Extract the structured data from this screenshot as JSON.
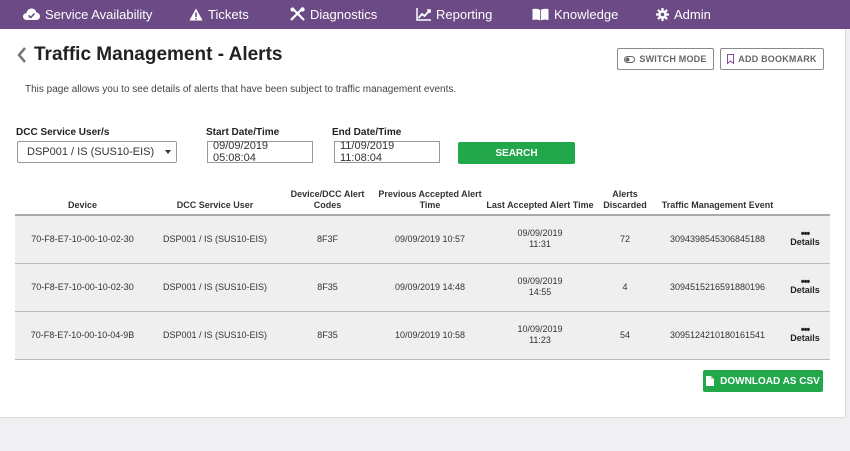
{
  "nav": {
    "items": [
      {
        "label": "Service Availability",
        "icon": "cloud-check-icon"
      },
      {
        "label": "Tickets",
        "icon": "warning-icon"
      },
      {
        "label": "Diagnostics",
        "icon": "tools-icon"
      },
      {
        "label": "Reporting",
        "icon": "line-chart-icon"
      },
      {
        "label": "Knowledge",
        "icon": "book-icon"
      },
      {
        "label": "Admin",
        "icon": "gear-icon"
      }
    ]
  },
  "page": {
    "title": "Traffic Management - Alerts",
    "intro": "This page allows you to see details of alerts that have been subject to traffic management events.",
    "switch_mode": "SWITCH MODE",
    "add_bookmark": "ADD BOOKMARK"
  },
  "filters": {
    "user_label": "DCC Service User/s",
    "user_value": "DSP001 / IS (SUS10-EIS)",
    "start_label": "Start Date/Time",
    "start_value": "09/09/2019 05:08:04",
    "end_label": "End Date/Time",
    "end_value": "11/09/2019 11:08:04",
    "search": "SEARCH"
  },
  "table": {
    "headers": [
      "Device",
      "DCC Service User",
      "Device/DCC Alert Codes",
      "Previous Accepted Alert Time",
      "Last Accepted Alert Time",
      "Alerts Discarded",
      "Traffic Management Event",
      ""
    ],
    "rows": [
      {
        "device": "70-F8-E7-10-00-10-02-30",
        "user": "DSP001 / IS (SUS10-EIS)",
        "code": "8F3F",
        "prev": "09/09/2019 10:57",
        "last_date": "09/09/2019",
        "last_time": "11:31",
        "discarded": "72",
        "event": "3094398545306845188",
        "details": "Details"
      },
      {
        "device": "70-F8-E7-10-00-10-02-30",
        "user": "DSP001 / IS (SUS10-EIS)",
        "code": "8F35",
        "prev": "09/09/2019 14:48",
        "last_date": "09/09/2019",
        "last_time": "14:55",
        "discarded": "4",
        "event": "3094515216591880196",
        "details": "Details"
      },
      {
        "device": "70-F8-E7-10-00-10-04-9B",
        "user": "DSP001 / IS (SUS10-EIS)",
        "code": "8F35",
        "prev": "10/09/2019 10:58",
        "last_date": "10/09/2019",
        "last_time": "11:23",
        "discarded": "54",
        "event": "3095124210180161541",
        "details": "Details"
      }
    ]
  },
  "download_csv": "DOWNLOAD AS CSV",
  "colors": {
    "nav": "#6b4a86",
    "green": "#22a84a"
  }
}
